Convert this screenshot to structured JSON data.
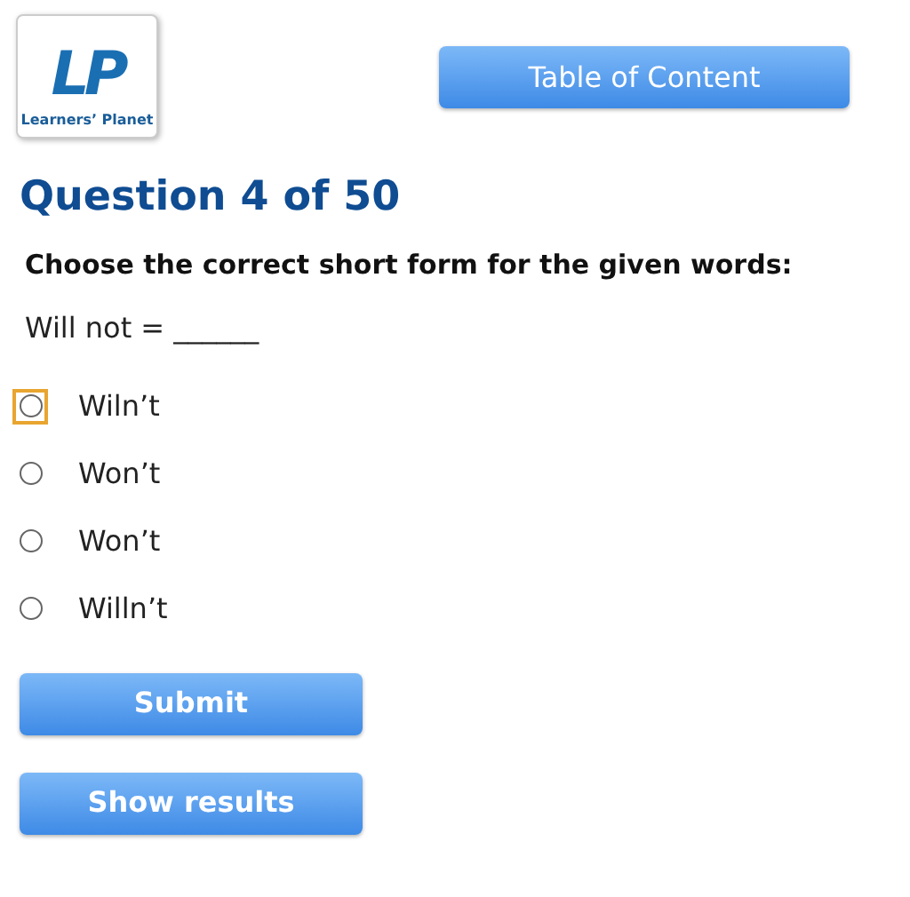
{
  "logo": {
    "mark": "LP",
    "caption": "Learners’ Planet"
  },
  "toc_button": "Table of Content",
  "heading": "Question 4 of 50",
  "prompt": "Choose the correct short form for the given words:",
  "question": "Will not = ______",
  "options": [
    {
      "label": "Wiln’t",
      "selected": false,
      "focused": true
    },
    {
      "label": "Won’t",
      "selected": false,
      "focused": false
    },
    {
      "label": "Won’t",
      "selected": false,
      "focused": false
    },
    {
      "label": "Willn’t",
      "selected": false,
      "focused": false
    }
  ],
  "buttons": [
    "Submit",
    "Show results"
  ]
}
